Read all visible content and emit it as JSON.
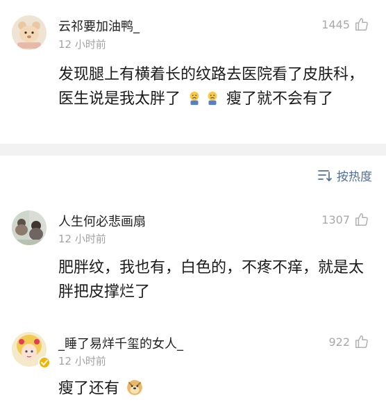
{
  "comments": [
    {
      "username": "云祁要加油鸭_",
      "time": "12 小时前",
      "likes": "1445",
      "text_a": "发现腿上有横着长的纹路去医院看了皮肤科，医生说是我太胖了",
      "text_b": "瘦了就不会有了",
      "avatar_icon": "bear-avatar-icon"
    },
    {
      "username": "人生何必悲画扇",
      "time": "12 小时前",
      "likes": "1307",
      "text": "肥胖纹，我也有，白色的，不疼不痒，就是太胖把皮撑烂了",
      "avatar_icon": "photo-avatar-icon"
    },
    {
      "username": "_睡了易烊千玺的女人_",
      "time": "12 小时前",
      "likes": "922",
      "text": "瘦了还有",
      "avatar_icon": "anime-avatar-icon"
    }
  ],
  "sort": {
    "label": "按热度"
  },
  "colors": {
    "link": "#4f6f95",
    "meta": "#a3a3a3",
    "divider": "#f2f2f2",
    "badge": "#f5b301"
  }
}
